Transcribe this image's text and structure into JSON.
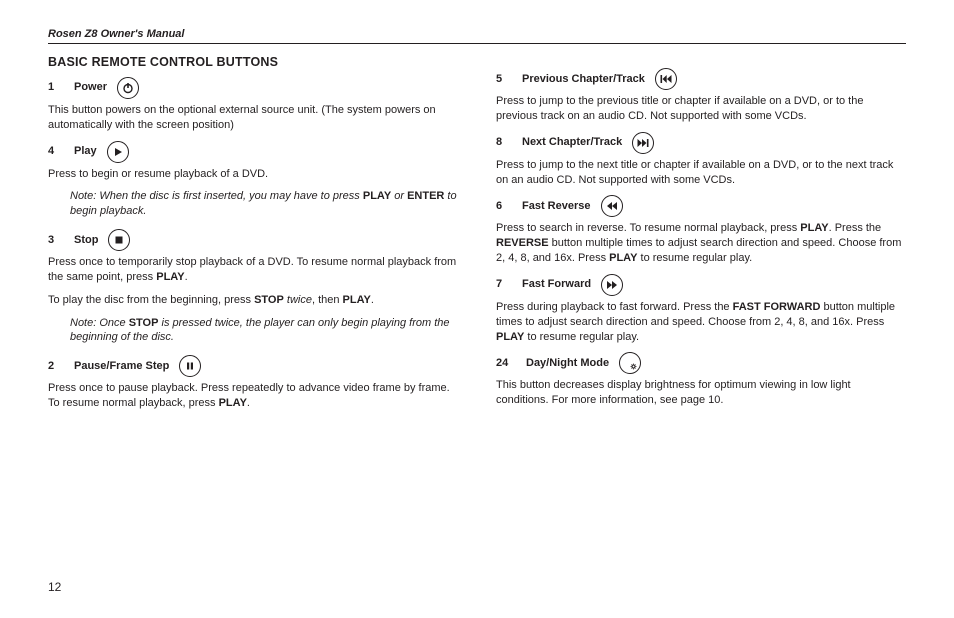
{
  "manual_title": "Rosen Z8 Owner's Manual",
  "section_heading": "BASIC REMOTE CONTROL BUTTONS",
  "page_number": "12",
  "left": {
    "power": {
      "num": "1",
      "label": "Power",
      "p1": "This button powers on the optional external source unit. (The system powers on automatically with the screen position)"
    },
    "play": {
      "num": "4",
      "label": "Play",
      "p1": "Press to begin or resume playback of a DVD.",
      "note_a": "Note: When the disc is first inserted, you may have to press ",
      "note_b1": "PLAY",
      "note_mid": " or ",
      "note_b2": "ENTER",
      "note_end": " to begin playback."
    },
    "stop": {
      "num": "3",
      "label": "Stop",
      "p1a": "Press once to temporarily stop playback of a DVD. To resume normal playback from the same point, press ",
      "p1b": "PLAY",
      "p1c": ".",
      "p2a": "To play the disc from the beginning, press ",
      "p2b": "STOP",
      "p2c": " twice",
      "p2d": ", then ",
      "p2e": "PLAY",
      "p2f": ".",
      "note_a": "Note: Once ",
      "note_b": "STOP",
      "note_c": " is pressed twice, the player can only begin playing from the beginning of the disc."
    },
    "pause": {
      "num": "2",
      "label": "Pause/Frame Step",
      "p1a": "Press once to pause playback. Press repeatedly to advance video frame by frame. To resume normal playback, press ",
      "p1b": "PLAY",
      "p1c": "."
    }
  },
  "right": {
    "prev": {
      "num": "5",
      "label": "Previous Chapter/Track",
      "p1": "Press to jump to the previous title or chapter if available on a DVD, or to the previous track on an audio CD. Not supported with some VCDs."
    },
    "next": {
      "num": "8",
      "label": "Next Chapter/Track",
      "p1": "Press to jump to the next title or chapter if available on a DVD, or to the next track on an audio CD. Not supported with some VCDs."
    },
    "frev": {
      "num": "6",
      "label": "Fast Reverse",
      "p1a": "Press to search in reverse. To resume normal playback, press ",
      "p1b": "PLAY",
      "p1c": ". Press the ",
      "p1d": "REVERSE",
      "p1e": " button multiple times to adjust search direction and speed. Choose from 2, 4, 8, and 16x. Press ",
      "p1f": "PLAY",
      "p1g": " to resume regular play."
    },
    "ffwd": {
      "num": "7",
      "label": "Fast Forward",
      "p1a": "Press during playback to fast forward. Press the ",
      "p1b": "FAST FORWARD",
      "p1c": " button multiple times to adjust search direction and speed. Choose from 2, 4, 8, and 16x. Press ",
      "p1d": "PLAY",
      "p1e": " to resume regular play."
    },
    "daynight": {
      "num": "24",
      "label": "Day/Night Mode",
      "p1": "This button decreases display brightness for optimum viewing in low light conditions.  For more information, see page 10."
    }
  }
}
